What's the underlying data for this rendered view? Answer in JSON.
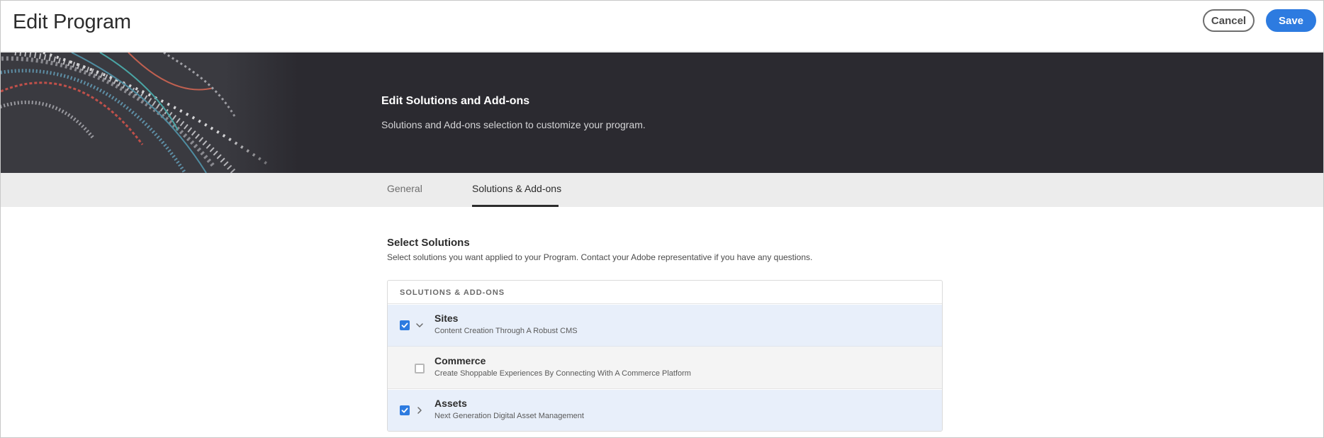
{
  "header": {
    "title": "Edit Program",
    "cancel_label": "Cancel",
    "save_label": "Save"
  },
  "hero": {
    "title": "Edit Solutions and Add-ons",
    "subtitle": "Solutions and Add-ons selection to customize your program."
  },
  "tabs": [
    {
      "label": "General",
      "active": false
    },
    {
      "label": "Solutions & Add-ons",
      "active": true
    }
  ],
  "section": {
    "title": "Select Solutions",
    "description": "Select solutions you want applied to your Program. Contact your Adobe representative if you have any questions."
  },
  "table": {
    "header": "SOLUTIONS & ADD-ONS",
    "rows": [
      {
        "name": "Sites",
        "description": "Content Creation Through A Robust CMS",
        "checked": true,
        "expander": "chevron-down-icon"
      },
      {
        "name": "Commerce",
        "description": "Create Shoppable Experiences By Connecting With A Commerce Platform",
        "checked": false
      },
      {
        "name": "Assets",
        "description": "Next Generation Digital Asset Management",
        "checked": true,
        "expander": "chevron-right-icon"
      }
    ]
  },
  "colors": {
    "accent": "#2d7be0",
    "hero_bg": "#2b2a30",
    "tabbar_bg": "#ececec",
    "selected_row_bg": "#e8effa"
  }
}
